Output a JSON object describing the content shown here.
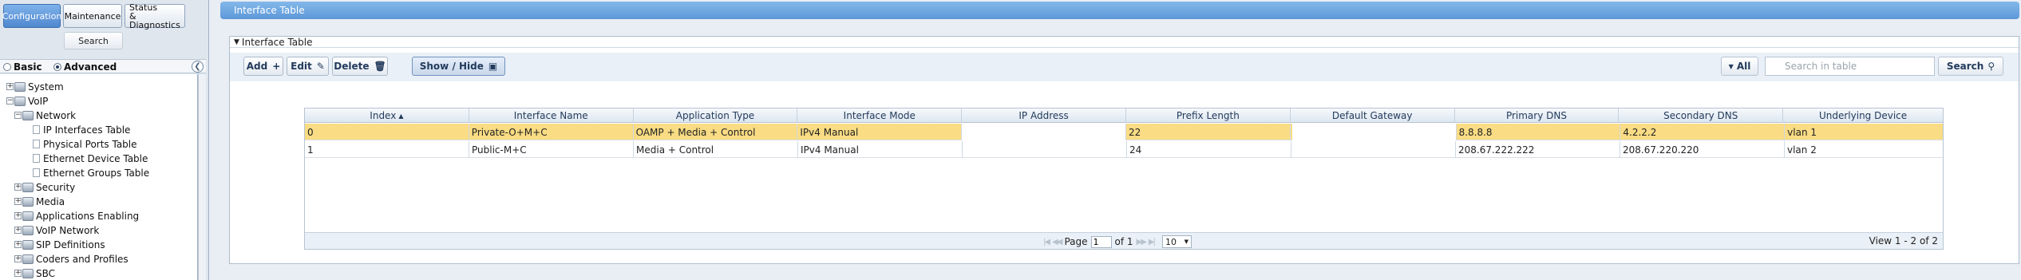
{
  "nav": {
    "configuration": "Configuration",
    "maintenance": "Maintenance",
    "status_line1": "Status",
    "status_line2": "& Diagnostics",
    "search": "Search"
  },
  "view": {
    "basic": "Basic",
    "advanced": "Advanced"
  },
  "tree": {
    "system": "System",
    "voip": "VoIP",
    "network": "Network",
    "ip_interfaces": "IP Interfaces Table",
    "physical_ports": "Physical Ports Table",
    "ethernet_device": "Ethernet Device Table",
    "ethernet_groups": "Ethernet Groups Table",
    "security": "Security",
    "media": "Media",
    "applications": "Applications Enabling",
    "voip_network": "VoIP Network",
    "sip_definitions": "SIP Definitions",
    "coders": "Coders and Profiles",
    "sbc": "SBC"
  },
  "page": {
    "title": "Interface Table",
    "panel_title": "Interface Table"
  },
  "toolbar": {
    "add": "Add",
    "edit": "Edit",
    "delete": "Delete",
    "show_hide": "Show / Hide",
    "all": "All",
    "search_placeholder": "Search in table",
    "search": "Search"
  },
  "table": {
    "columns": [
      "Index",
      "Interface Name",
      "Application Type",
      "Interface Mode",
      "IP Address",
      "Prefix Length",
      "Default Gateway",
      "Primary DNS",
      "Secondary DNS",
      "Underlying Device"
    ],
    "rows": [
      [
        "0",
        "Private-O+M+C",
        "OAMP + Media + Control",
        "IPv4 Manual",
        "",
        "22",
        "",
        "8.8.8.8",
        "4.2.2.2",
        "vlan 1"
      ],
      [
        "1",
        "Public-M+C",
        "Media + Control",
        "IPv4 Manual",
        "",
        "24",
        "",
        "208.67.222.222",
        "208.67.220.220",
        "vlan 2"
      ]
    ]
  },
  "pager": {
    "page_label": "Page",
    "page": "1",
    "of_label": "of 1",
    "rows_per_page": "10",
    "view_info": "View 1 - 2 of 2"
  }
}
